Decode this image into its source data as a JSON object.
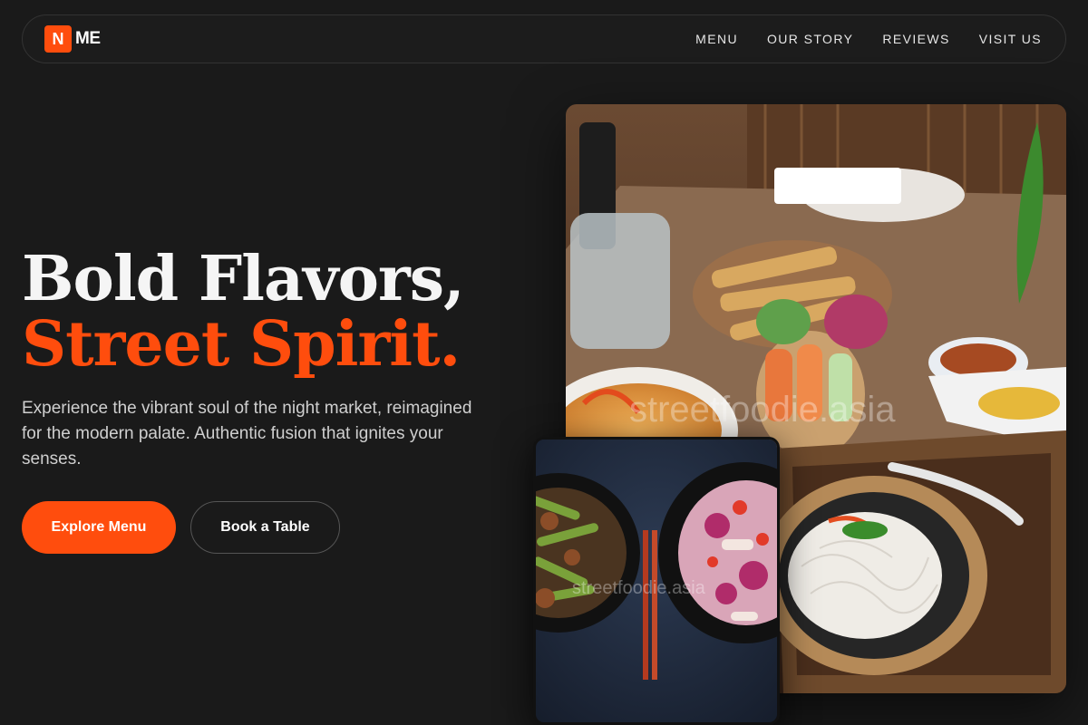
{
  "brand": {
    "mark": "N",
    "name": "ME",
    "accent": "#ff4d0d"
  },
  "nav": {
    "links": [
      {
        "label": "MENU"
      },
      {
        "label": "OUR STORY"
      },
      {
        "label": "REVIEWS"
      },
      {
        "label": "VISIT US"
      }
    ]
  },
  "hero": {
    "title_line1": "Bold Flavors,",
    "title_line2": "Street Spirit.",
    "subtitle": "Experience the vibrant soul of the night market, reimagined for the modern palate. Authentic fusion that ignites your senses.",
    "primary_cta": "Explore Menu",
    "secondary_cta": "Book a Table"
  },
  "images": {
    "main_watermark": "streetfoodie.asia",
    "small_watermark": "streetfoodie.asia"
  },
  "colors": {
    "background": "#1a1a1a",
    "accent": "#ff4d0d",
    "text": "#f5f5f5"
  }
}
